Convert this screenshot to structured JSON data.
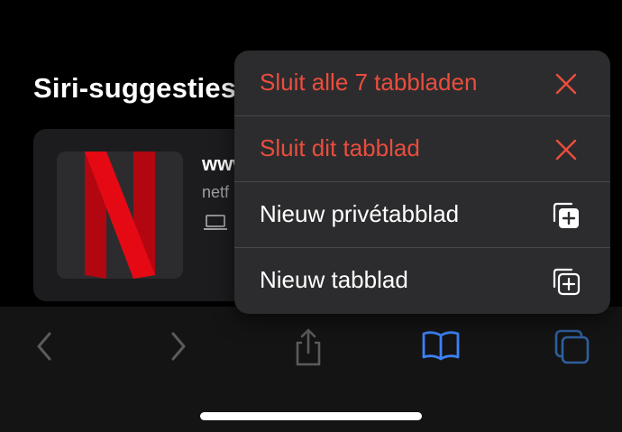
{
  "siri_section": {
    "title": "Siri-suggesties"
  },
  "suggestion": {
    "title": "www",
    "url": "netf",
    "device_icon": "laptop-icon",
    "thumbnail_icon": "netflix-logo"
  },
  "tab_menu": {
    "items": [
      {
        "label": "Sluit alle 7 tabbladen",
        "icon": "close-x-icon",
        "style": "destructive"
      },
      {
        "label": "Sluit dit tabblad",
        "icon": "close-x-icon",
        "style": "destructive"
      },
      {
        "label": "Nieuw privétabblad",
        "icon": "private-tab-plus-icon",
        "style": "normal"
      },
      {
        "label": "Nieuw tabblad",
        "icon": "new-tab-plus-icon",
        "style": "normal"
      }
    ]
  },
  "toolbar": {
    "buttons": [
      {
        "name": "back",
        "icon": "chevron-left-icon"
      },
      {
        "name": "forward",
        "icon": "chevron-right-icon"
      },
      {
        "name": "share",
        "icon": "share-icon"
      },
      {
        "name": "bookmarks",
        "icon": "book-icon"
      },
      {
        "name": "tabs",
        "icon": "tabs-icon"
      }
    ]
  },
  "colors": {
    "background": "#000000",
    "card": "#1c1c1e",
    "menu": "#2c2c2e",
    "destructive": "#eb4d3d",
    "accent_blue": "#3b82f6",
    "netflix_red": "#e50914"
  }
}
